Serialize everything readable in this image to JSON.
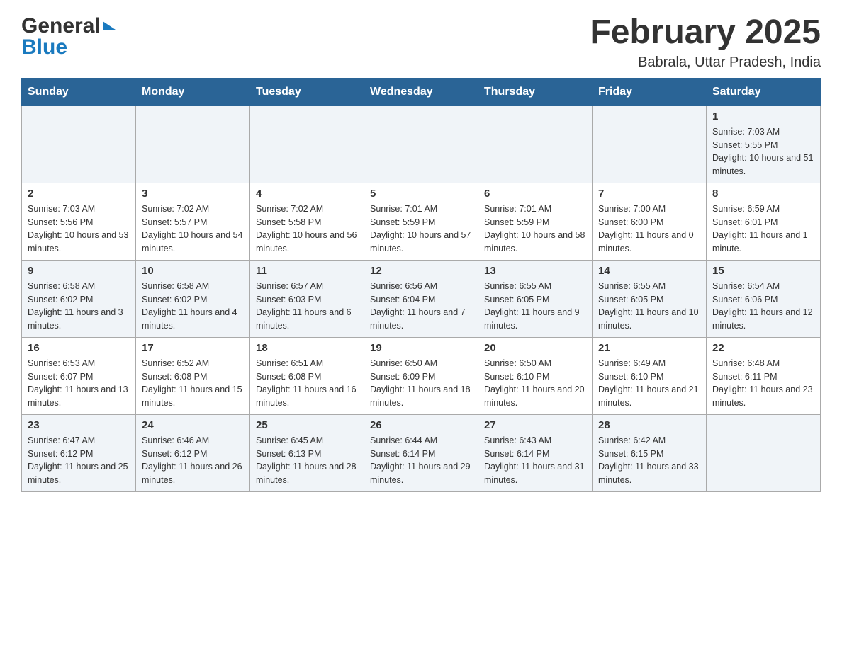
{
  "logo": {
    "general": "General",
    "blue": "Blue"
  },
  "header": {
    "month_title": "February 2025",
    "location": "Babrala, Uttar Pradesh, India"
  },
  "days_of_week": [
    "Sunday",
    "Monday",
    "Tuesday",
    "Wednesday",
    "Thursday",
    "Friday",
    "Saturday"
  ],
  "weeks": [
    {
      "days": [
        {
          "num": "",
          "info": ""
        },
        {
          "num": "",
          "info": ""
        },
        {
          "num": "",
          "info": ""
        },
        {
          "num": "",
          "info": ""
        },
        {
          "num": "",
          "info": ""
        },
        {
          "num": "",
          "info": ""
        },
        {
          "num": "1",
          "info": "Sunrise: 7:03 AM\nSunset: 5:55 PM\nDaylight: 10 hours and 51 minutes."
        }
      ]
    },
    {
      "days": [
        {
          "num": "2",
          "info": "Sunrise: 7:03 AM\nSunset: 5:56 PM\nDaylight: 10 hours and 53 minutes."
        },
        {
          "num": "3",
          "info": "Sunrise: 7:02 AM\nSunset: 5:57 PM\nDaylight: 10 hours and 54 minutes."
        },
        {
          "num": "4",
          "info": "Sunrise: 7:02 AM\nSunset: 5:58 PM\nDaylight: 10 hours and 56 minutes."
        },
        {
          "num": "5",
          "info": "Sunrise: 7:01 AM\nSunset: 5:59 PM\nDaylight: 10 hours and 57 minutes."
        },
        {
          "num": "6",
          "info": "Sunrise: 7:01 AM\nSunset: 5:59 PM\nDaylight: 10 hours and 58 minutes."
        },
        {
          "num": "7",
          "info": "Sunrise: 7:00 AM\nSunset: 6:00 PM\nDaylight: 11 hours and 0 minutes."
        },
        {
          "num": "8",
          "info": "Sunrise: 6:59 AM\nSunset: 6:01 PM\nDaylight: 11 hours and 1 minute."
        }
      ]
    },
    {
      "days": [
        {
          "num": "9",
          "info": "Sunrise: 6:58 AM\nSunset: 6:02 PM\nDaylight: 11 hours and 3 minutes."
        },
        {
          "num": "10",
          "info": "Sunrise: 6:58 AM\nSunset: 6:02 PM\nDaylight: 11 hours and 4 minutes."
        },
        {
          "num": "11",
          "info": "Sunrise: 6:57 AM\nSunset: 6:03 PM\nDaylight: 11 hours and 6 minutes."
        },
        {
          "num": "12",
          "info": "Sunrise: 6:56 AM\nSunset: 6:04 PM\nDaylight: 11 hours and 7 minutes."
        },
        {
          "num": "13",
          "info": "Sunrise: 6:55 AM\nSunset: 6:05 PM\nDaylight: 11 hours and 9 minutes."
        },
        {
          "num": "14",
          "info": "Sunrise: 6:55 AM\nSunset: 6:05 PM\nDaylight: 11 hours and 10 minutes."
        },
        {
          "num": "15",
          "info": "Sunrise: 6:54 AM\nSunset: 6:06 PM\nDaylight: 11 hours and 12 minutes."
        }
      ]
    },
    {
      "days": [
        {
          "num": "16",
          "info": "Sunrise: 6:53 AM\nSunset: 6:07 PM\nDaylight: 11 hours and 13 minutes."
        },
        {
          "num": "17",
          "info": "Sunrise: 6:52 AM\nSunset: 6:08 PM\nDaylight: 11 hours and 15 minutes."
        },
        {
          "num": "18",
          "info": "Sunrise: 6:51 AM\nSunset: 6:08 PM\nDaylight: 11 hours and 16 minutes."
        },
        {
          "num": "19",
          "info": "Sunrise: 6:50 AM\nSunset: 6:09 PM\nDaylight: 11 hours and 18 minutes."
        },
        {
          "num": "20",
          "info": "Sunrise: 6:50 AM\nSunset: 6:10 PM\nDaylight: 11 hours and 20 minutes."
        },
        {
          "num": "21",
          "info": "Sunrise: 6:49 AM\nSunset: 6:10 PM\nDaylight: 11 hours and 21 minutes."
        },
        {
          "num": "22",
          "info": "Sunrise: 6:48 AM\nSunset: 6:11 PM\nDaylight: 11 hours and 23 minutes."
        }
      ]
    },
    {
      "days": [
        {
          "num": "23",
          "info": "Sunrise: 6:47 AM\nSunset: 6:12 PM\nDaylight: 11 hours and 25 minutes."
        },
        {
          "num": "24",
          "info": "Sunrise: 6:46 AM\nSunset: 6:12 PM\nDaylight: 11 hours and 26 minutes."
        },
        {
          "num": "25",
          "info": "Sunrise: 6:45 AM\nSunset: 6:13 PM\nDaylight: 11 hours and 28 minutes."
        },
        {
          "num": "26",
          "info": "Sunrise: 6:44 AM\nSunset: 6:14 PM\nDaylight: 11 hours and 29 minutes."
        },
        {
          "num": "27",
          "info": "Sunrise: 6:43 AM\nSunset: 6:14 PM\nDaylight: 11 hours and 31 minutes."
        },
        {
          "num": "28",
          "info": "Sunrise: 6:42 AM\nSunset: 6:15 PM\nDaylight: 11 hours and 33 minutes."
        },
        {
          "num": "",
          "info": ""
        }
      ]
    }
  ]
}
